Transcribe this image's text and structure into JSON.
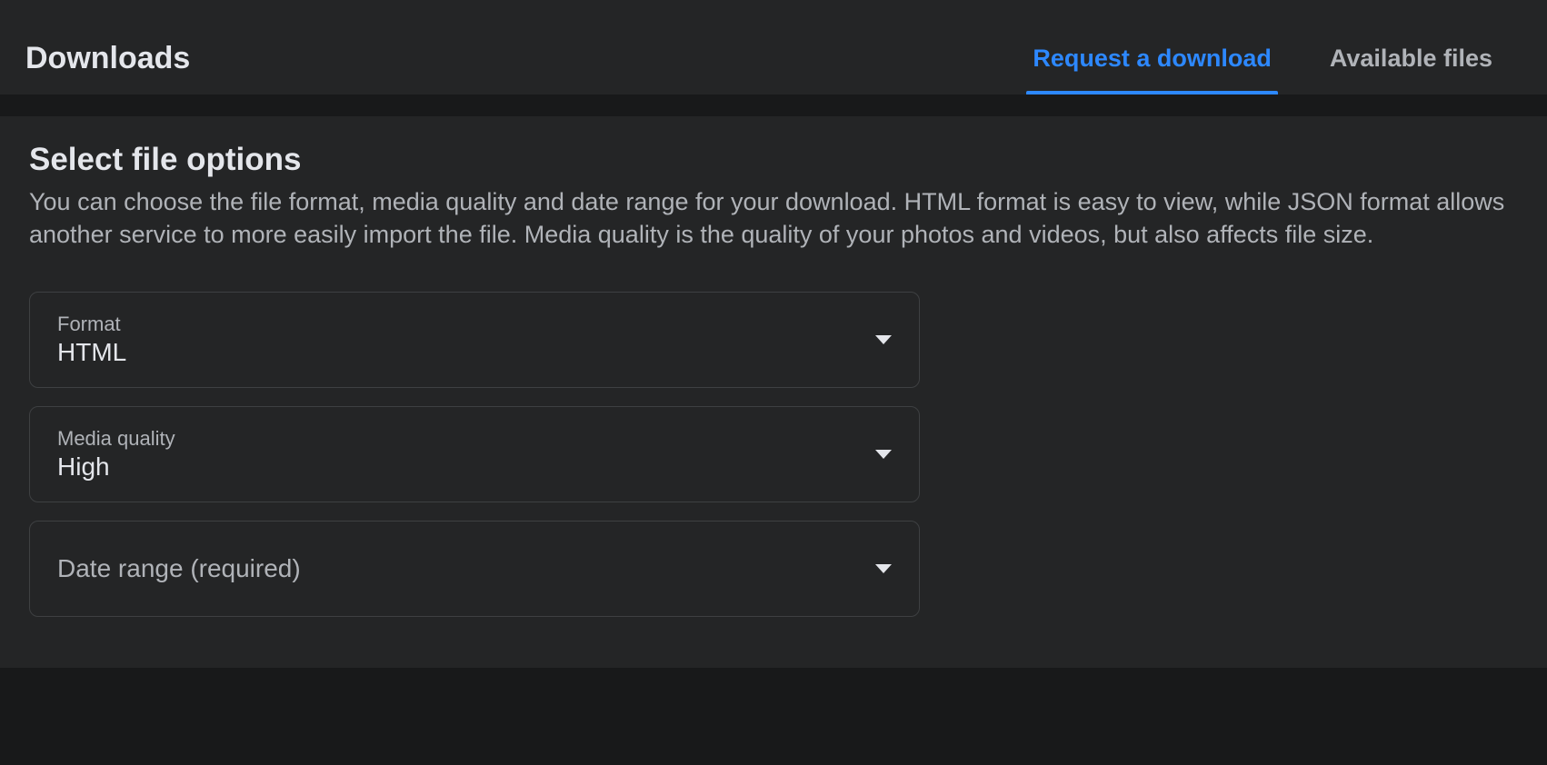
{
  "header": {
    "title": "Downloads",
    "tabs": [
      {
        "label": "Request a download",
        "active": true
      },
      {
        "label": "Available files",
        "active": false
      }
    ]
  },
  "section": {
    "title": "Select file options",
    "description": "You can choose the file format, media quality and date range for your download. HTML format is easy to view, while JSON format allows another service to more easily import the file. Media quality is the quality of your photos and videos, but also affects file size."
  },
  "selects": {
    "format": {
      "label": "Format",
      "value": "HTML"
    },
    "media_quality": {
      "label": "Media quality",
      "value": "High"
    },
    "date_range": {
      "placeholder": "Date range (required)"
    }
  }
}
